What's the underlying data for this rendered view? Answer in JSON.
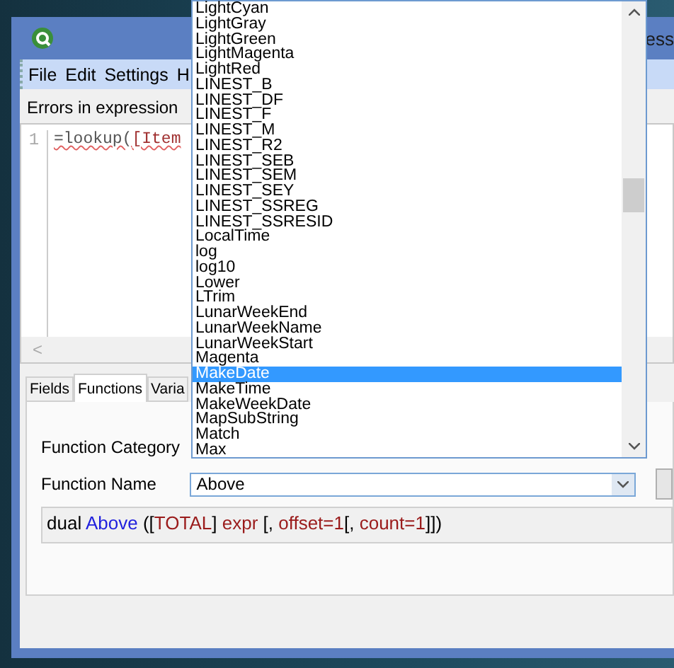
{
  "window": {
    "title": "ess",
    "menu": [
      "File",
      "Edit",
      "Settings",
      "H"
    ]
  },
  "errors_label": "Errors in expression",
  "editor": {
    "line_number": "1",
    "tokens": [
      {
        "text": "=lookup(",
        "kind": "plain"
      },
      {
        "text": "[Item",
        "kind": "field"
      }
    ],
    "scroll_left": "<"
  },
  "tabs": [
    {
      "label": "Fields",
      "selected": false
    },
    {
      "label": "Functions",
      "selected": true
    },
    {
      "label": "Varia",
      "selected": false
    }
  ],
  "function_category": {
    "label": "Function Category"
  },
  "function_name": {
    "label": "Function Name",
    "value": "Above"
  },
  "syntax": [
    {
      "text": "dual ",
      "kind": "plain"
    },
    {
      "text": "Above",
      "kind": "name"
    },
    {
      "text": " ([",
      "kind": "plain"
    },
    {
      "text": "TOTAL",
      "kind": "param"
    },
    {
      "text": "] ",
      "kind": "plain"
    },
    {
      "text": "expr",
      "kind": "param"
    },
    {
      "text": " [, ",
      "kind": "plain"
    },
    {
      "text": "offset=1",
      "kind": "param"
    },
    {
      "text": "[, ",
      "kind": "plain"
    },
    {
      "text": "count=1",
      "kind": "param"
    },
    {
      "text": "]])",
      "kind": "plain"
    }
  ],
  "dropdown": {
    "items": [
      {
        "label": "LightCyan",
        "selected": false
      },
      {
        "label": "LightGray",
        "selected": false
      },
      {
        "label": "LightGreen",
        "selected": false
      },
      {
        "label": "LightMagenta",
        "selected": false
      },
      {
        "label": "LightRed",
        "selected": false
      },
      {
        "label": "LINEST_B",
        "selected": false
      },
      {
        "label": "LINEST_DF",
        "selected": false
      },
      {
        "label": "LINEST_F",
        "selected": false
      },
      {
        "label": "LINEST_M",
        "selected": false
      },
      {
        "label": "LINEST_R2",
        "selected": false
      },
      {
        "label": "LINEST_SEB",
        "selected": false
      },
      {
        "label": "LINEST_SEM",
        "selected": false
      },
      {
        "label": "LINEST_SEY",
        "selected": false
      },
      {
        "label": "LINEST_SSREG",
        "selected": false
      },
      {
        "label": "LINEST_SSRESID",
        "selected": false
      },
      {
        "label": "LocalTime",
        "selected": false
      },
      {
        "label": "log",
        "selected": false
      },
      {
        "label": "log10",
        "selected": false
      },
      {
        "label": "Lower",
        "selected": false
      },
      {
        "label": "LTrim",
        "selected": false
      },
      {
        "label": "LunarWeekEnd",
        "selected": false
      },
      {
        "label": "LunarWeekName",
        "selected": false
      },
      {
        "label": "LunarWeekStart",
        "selected": false
      },
      {
        "label": "Magenta",
        "selected": false
      },
      {
        "label": "MakeDate",
        "selected": true
      },
      {
        "label": "MakeTime",
        "selected": false
      },
      {
        "label": "MakeWeekDate",
        "selected": false
      },
      {
        "label": "MapSubString",
        "selected": false
      },
      {
        "label": "Match",
        "selected": false
      },
      {
        "label": "Max",
        "selected": false
      }
    ]
  }
}
